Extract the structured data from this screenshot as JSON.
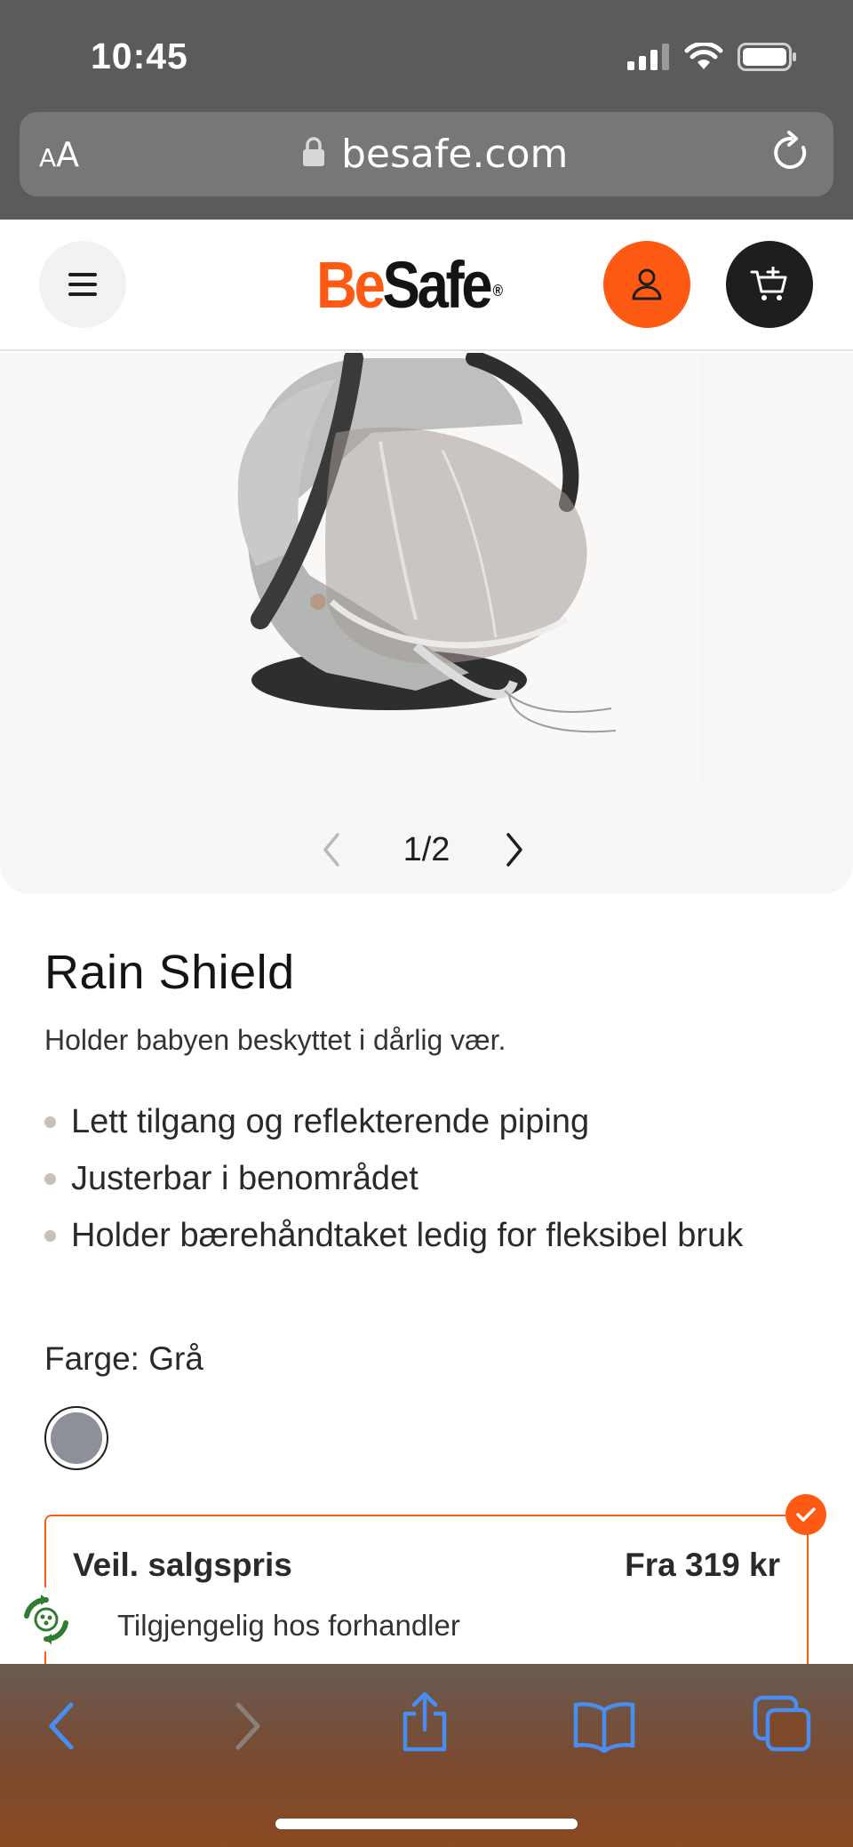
{
  "status_bar": {
    "time": "10:45"
  },
  "browser": {
    "text_size_small": "A",
    "text_size_large": "A",
    "url": "besafe.com"
  },
  "header": {
    "logo_part1": "Be",
    "logo_part2": "Safe",
    "logo_mark": "®",
    "brand_color": "#ff5a14"
  },
  "gallery": {
    "counter": "1/2"
  },
  "product": {
    "title": "Rain Shield",
    "subtitle": "Holder babyen beskyttet i dårlig vær.",
    "features": [
      "Lett tilgang og reflekterende piping",
      "Justerbar i benområdet",
      "Holder bærehåndtaket ledig for fleksibel bruk"
    ],
    "color_label": "Farge: Grå",
    "swatch_color": "#8e9099"
  },
  "price": {
    "label": "Veil. salgspris",
    "value": "Fra 319 kr",
    "availability": "Tilgjengelig hos forhandler"
  },
  "icons": {
    "menu": "hamburger-icon",
    "account": "user-icon",
    "cart": "cart-icon",
    "lock": "lock-icon",
    "reload": "reload-icon",
    "prev": "chevron-left-icon",
    "next": "chevron-right-icon",
    "check": "check-icon",
    "eco": "recycle-icon"
  }
}
